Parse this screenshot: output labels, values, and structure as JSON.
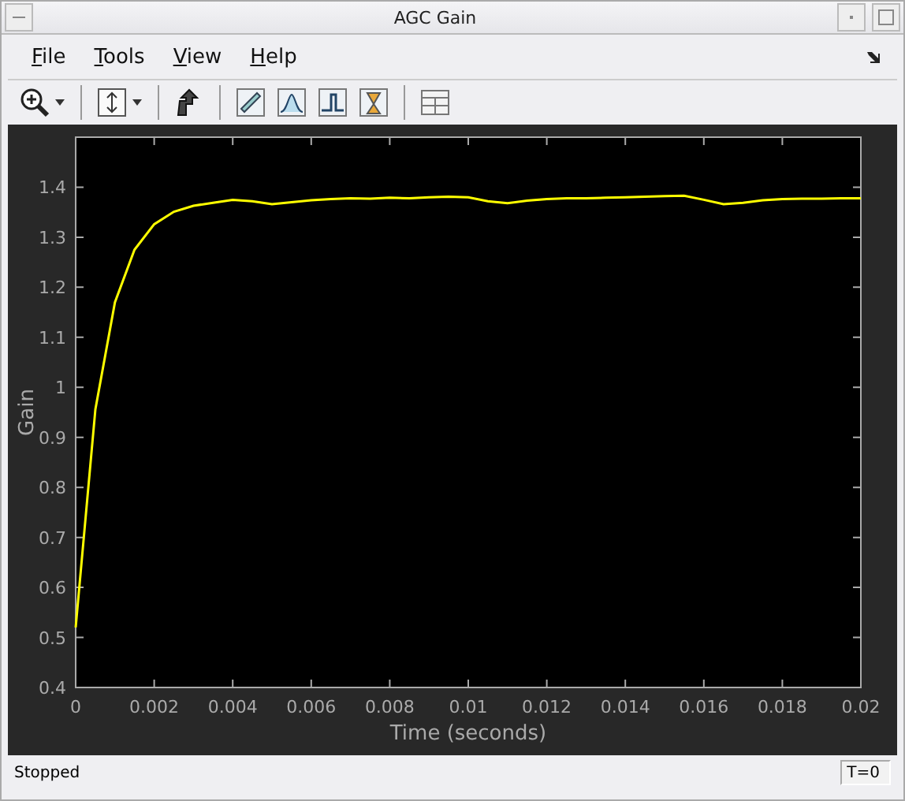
{
  "window": {
    "title": "AGC Gain"
  },
  "menu": [
    {
      "label": "File"
    },
    {
      "label": "Tools"
    },
    {
      "label": "View"
    },
    {
      "label": "Help"
    }
  ],
  "plot": {
    "chart_data": {
      "type": "line",
      "xlabel": "Time (seconds)",
      "ylabel": "Gain",
      "xlim": [
        0,
        0.02
      ],
      "ylim": [
        0.4,
        1.5
      ],
      "xticks": [
        {
          "value": 0,
          "label": "0"
        },
        {
          "value": 0.002,
          "label": "0.002"
        },
        {
          "value": 0.004,
          "label": "0.004"
        },
        {
          "value": 0.006,
          "label": "0.006"
        },
        {
          "value": 0.008,
          "label": "0.008"
        },
        {
          "value": 0.01,
          "label": "0.01"
        },
        {
          "value": 0.012,
          "label": "0.012"
        },
        {
          "value": 0.014,
          "label": "0.014"
        },
        {
          "value": 0.016,
          "label": "0.016"
        },
        {
          "value": 0.018,
          "label": "0.018"
        },
        {
          "value": 0.02,
          "label": "0.02"
        }
      ],
      "yticks": [
        {
          "value": 0.4,
          "label": "0.4"
        },
        {
          "value": 0.5,
          "label": "0.5"
        },
        {
          "value": 0.6,
          "label": "0.6"
        },
        {
          "value": 0.7,
          "label": "0.7"
        },
        {
          "value": 0.8,
          "label": "0.8"
        },
        {
          "value": 0.9,
          "label": "0.9"
        },
        {
          "value": 1,
          "label": "1"
        },
        {
          "value": 1.1,
          "label": "1.1"
        },
        {
          "value": 1.2,
          "label": "1.2"
        },
        {
          "value": 1.3,
          "label": "1.3"
        },
        {
          "value": 1.4,
          "label": "1.4"
        }
      ],
      "x": [
        0,
        0.0005,
        0.001,
        0.0015,
        0.002,
        0.0025,
        0.003,
        0.0035,
        0.004,
        0.0045,
        0.005,
        0.0055,
        0.006,
        0.0065,
        0.007,
        0.0075,
        0.008,
        0.0085,
        0.009,
        0.0095,
        0.01,
        0.0105,
        0.011,
        0.0115,
        0.012,
        0.0125,
        0.013,
        0.0135,
        0.014,
        0.0145,
        0.015,
        0.0155,
        0.016,
        0.0165,
        0.017,
        0.0175,
        0.018,
        0.0185,
        0.019,
        0.0195,
        0.02
      ],
      "series": [
        {
          "color": "#ffff00",
          "values": [
            0.52,
            0.956,
            1.17,
            1.275,
            1.326,
            1.351,
            1.363,
            1.369,
            1.375,
            1.372,
            1.366,
            1.37,
            1.374,
            1.376,
            1.378,
            1.377,
            1.379,
            1.378,
            1.38,
            1.381,
            1.38,
            1.372,
            1.368,
            1.373,
            1.376,
            1.378,
            1.378,
            1.379,
            1.38,
            1.381,
            1.382,
            1.383,
            1.375,
            1.366,
            1.369,
            1.374,
            1.376,
            1.377,
            1.377,
            1.378,
            1.378
          ]
        }
      ]
    }
  },
  "status_bar": {
    "state": "Stopped",
    "time": "T=0"
  }
}
